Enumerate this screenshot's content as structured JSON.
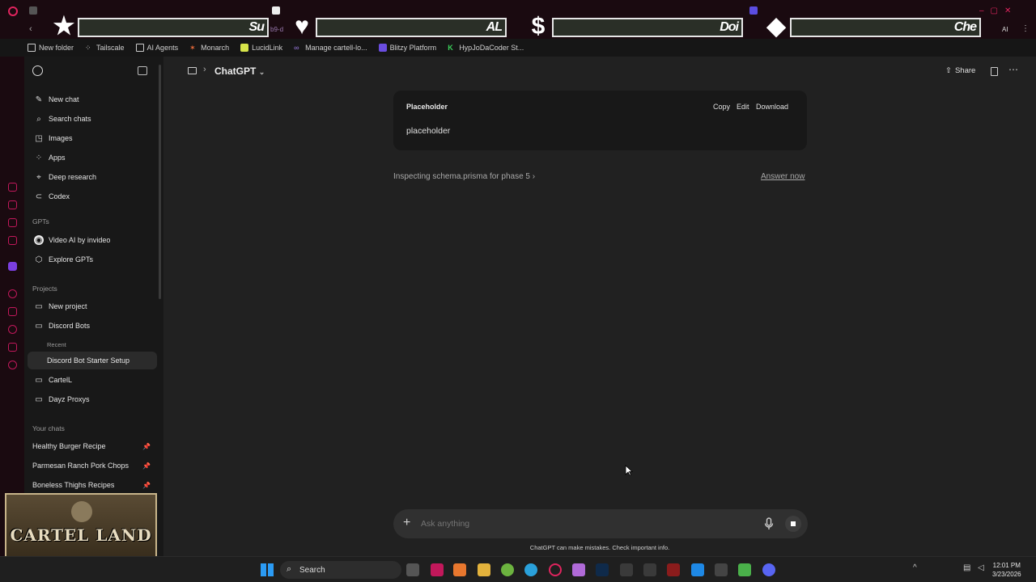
{
  "bookmarks": [
    {
      "label": "New folder",
      "icon": "folder-icon"
    },
    {
      "label": "Tailscale",
      "icon": "tailscale-icon"
    },
    {
      "label": "AI Agents",
      "icon": "folder-icon"
    },
    {
      "label": "Monarch",
      "icon": "monarch-icon"
    },
    {
      "label": "LucidLink",
      "icon": "lucidlink-icon"
    },
    {
      "label": "Manage cartell-lo...",
      "icon": "link-icon"
    },
    {
      "label": "Blitzy Platform",
      "icon": "blitzy-icon"
    },
    {
      "label": "HypJoDaCoder St...",
      "icon": "k-icon"
    }
  ],
  "banners": [
    {
      "symbol": "★",
      "text": "Su"
    },
    {
      "symbol": "♥",
      "text": "AL"
    },
    {
      "symbol": "$",
      "text": "Doi"
    },
    {
      "symbol": "◆",
      "text": "Che"
    }
  ],
  "address_partial": "b9-d",
  "address_right": "AI",
  "sidebar": {
    "nav": [
      {
        "label": "New chat",
        "icon": "edit-icon"
      },
      {
        "label": "Search chats",
        "icon": "search-icon"
      },
      {
        "label": "Images",
        "icon": "image-icon"
      },
      {
        "label": "Apps",
        "icon": "apps-icon"
      },
      {
        "label": "Deep research",
        "icon": "telescope-icon"
      },
      {
        "label": "Codex",
        "icon": "codex-icon"
      }
    ],
    "gpts_heading": "GPTs",
    "gpts": [
      {
        "label": "Video AI by invideo",
        "icon": "invideo-icon"
      },
      {
        "label": "Explore GPTs",
        "icon": "cube-icon"
      }
    ],
    "projects_heading": "Projects",
    "projects": [
      {
        "label": "New project",
        "icon": "folder-plus-icon"
      },
      {
        "label": "Discord Bots",
        "icon": "folder-icon"
      }
    ],
    "recent_label": "Recent",
    "recent_item": "Discord Bot Starter Setup",
    "more_projects": [
      {
        "label": "CartelL",
        "icon": "folder-icon"
      },
      {
        "label": "Dayz Proxys",
        "icon": "folder-icon"
      }
    ],
    "chats_heading": "Your chats",
    "chats": [
      {
        "label": "Healthy Burger Recipe"
      },
      {
        "label": "Parmesan Ranch Pork Chops"
      },
      {
        "label": "Boneless Thighs Recipes"
      }
    ]
  },
  "header": {
    "model": "ChatGPT",
    "share": "Share"
  },
  "canvas_card": {
    "title": "Placeholder",
    "body": "placeholder",
    "actions": [
      "Copy",
      "Edit",
      "Download"
    ]
  },
  "status": {
    "thinking": "Inspecting schema.prisma for phase 5",
    "answer_now": "Answer now"
  },
  "composer": {
    "placeholder": "Ask anything"
  },
  "disclaimer": "ChatGPT can make mistakes. Check important info.",
  "webcam": {
    "title": "CARTEL LAND"
  },
  "taskbar": {
    "search": "Search",
    "time": "12:01 PM",
    "date": "3/23/2026"
  },
  "colors": {
    "accent_pink": "#c2185b",
    "main_bg": "#212121",
    "sidebar_bg": "#181818"
  }
}
